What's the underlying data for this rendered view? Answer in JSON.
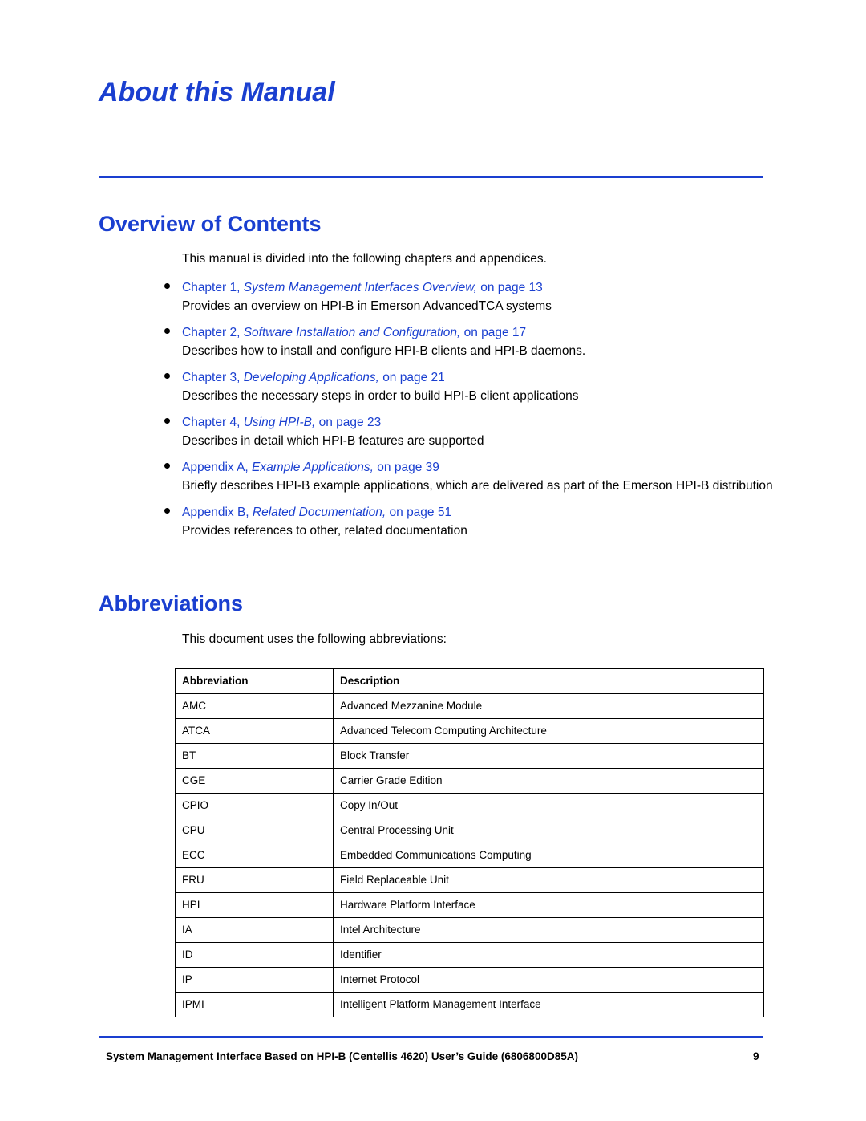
{
  "page": {
    "title": "About this Manual",
    "sections": {
      "overview": {
        "heading": "Overview of Contents",
        "intro": "This manual is divided into the following chapters and appendices.",
        "items": [
          {
            "label": "Chapter 1,",
            "ref": "System Management Interfaces Overview,",
            "on_page": "on page",
            "page": "13",
            "desc": "Provides an overview on HPI-B in Emerson AdvancedTCA systems"
          },
          {
            "label": "Chapter 2,",
            "ref": "Software Installation and Configuration,",
            "on_page": "on page",
            "page": "17",
            "desc": "Describes how to install and configure HPI-B clients and HPI-B daemons."
          },
          {
            "label": "Chapter 3,",
            "ref": "Developing Applications,",
            "on_page": "on page",
            "page": "21",
            "desc": "Describes the necessary steps in order to build HPI-B client applications"
          },
          {
            "label": "Chapter 4,",
            "ref": "Using HPI-B,",
            "on_page": "on page",
            "page": "23",
            "desc": "Describes in detail which HPI-B features are supported"
          },
          {
            "label": "Appendix A,",
            "ref": "Example Applications,",
            "on_page": "on page",
            "page": "39",
            "desc": "Briefly describes HPI-B example applications, which are delivered as part of the Emerson HPI-B distribution"
          },
          {
            "label": "Appendix B,",
            "ref": "Related Documentation,",
            "on_page": "on page",
            "page": "51",
            "desc": "Provides references to other, related documentation"
          }
        ]
      },
      "abbreviations": {
        "heading": "Abbreviations",
        "intro": "This document uses the following abbreviations:",
        "table": {
          "headers": [
            "Abbreviation",
            "Description"
          ],
          "rows": [
            [
              "AMC",
              "Advanced Mezzanine Module"
            ],
            [
              "ATCA",
              "Advanced Telecom Computing Architecture"
            ],
            [
              "BT",
              "Block Transfer"
            ],
            [
              "CGE",
              "Carrier Grade Edition"
            ],
            [
              "CPIO",
              "Copy In/Out"
            ],
            [
              "CPU",
              "Central Processing Unit"
            ],
            [
              "ECC",
              "Embedded Communications Computing"
            ],
            [
              "FRU",
              "Field Replaceable Unit"
            ],
            [
              "HPI",
              "Hardware Platform Interface"
            ],
            [
              "IA",
              "Intel Architecture"
            ],
            [
              "ID",
              "Identifier"
            ],
            [
              "IP",
              "Internet Protocol"
            ],
            [
              "IPMI",
              "Intelligent Platform Management Interface"
            ]
          ]
        }
      }
    },
    "footer": {
      "text": "System Management Interface Based on HPI-B (Centellis 4620) User’s Guide (6806800D85A)",
      "page_number": "9"
    },
    "colors": {
      "accent": "#1a3fd0"
    }
  }
}
